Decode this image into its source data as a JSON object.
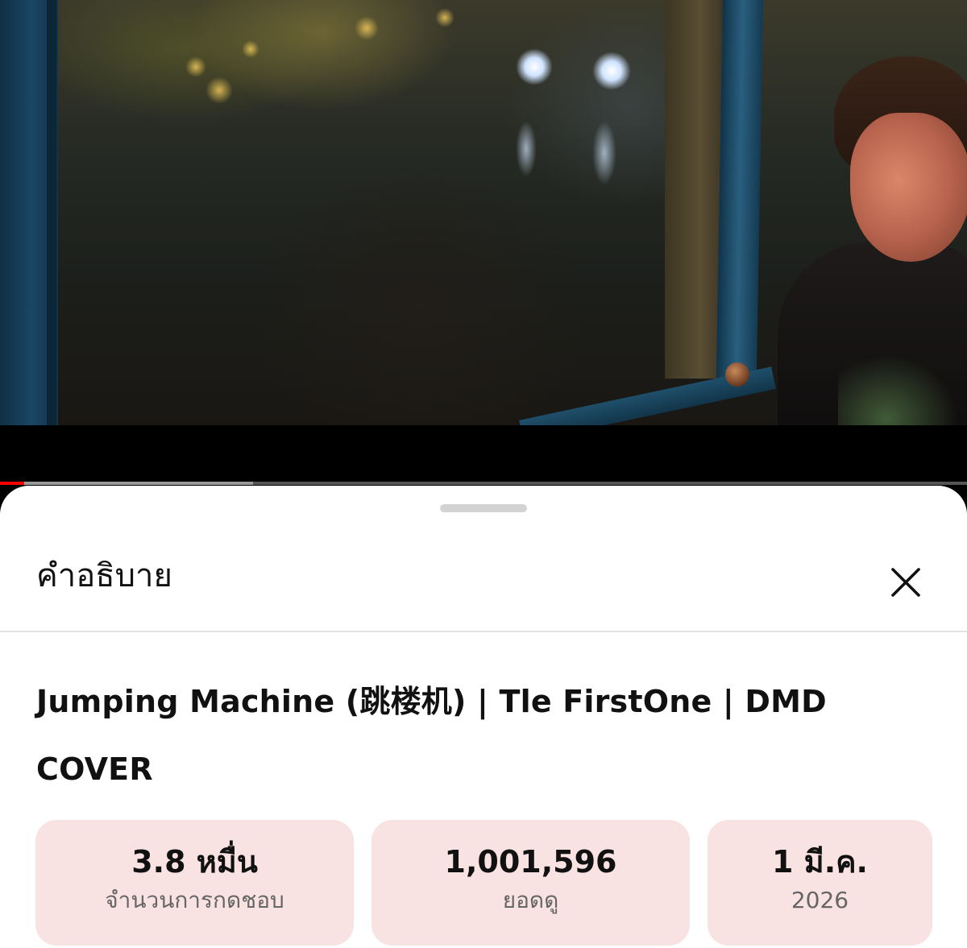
{
  "video": {
    "progress_played": 0.025,
    "progress_buffered": 0.262
  },
  "sheet": {
    "title": "คำอธิบาย",
    "close_icon": "close-icon"
  },
  "description": {
    "video_title": "Jumping Machine (跳楼机) | Tle FirstOne | DMD COVER"
  },
  "stats": {
    "likes": {
      "value": "3.8 หมื่น",
      "label": "จำนวนการกดชอบ"
    },
    "views": {
      "value": "1,001,596",
      "label": "ยอดดู"
    },
    "date": {
      "value": "1 มี.ค.",
      "label": "2026"
    }
  },
  "colors": {
    "progress": "#ff0000",
    "stat_background": "#f9e2e2"
  }
}
